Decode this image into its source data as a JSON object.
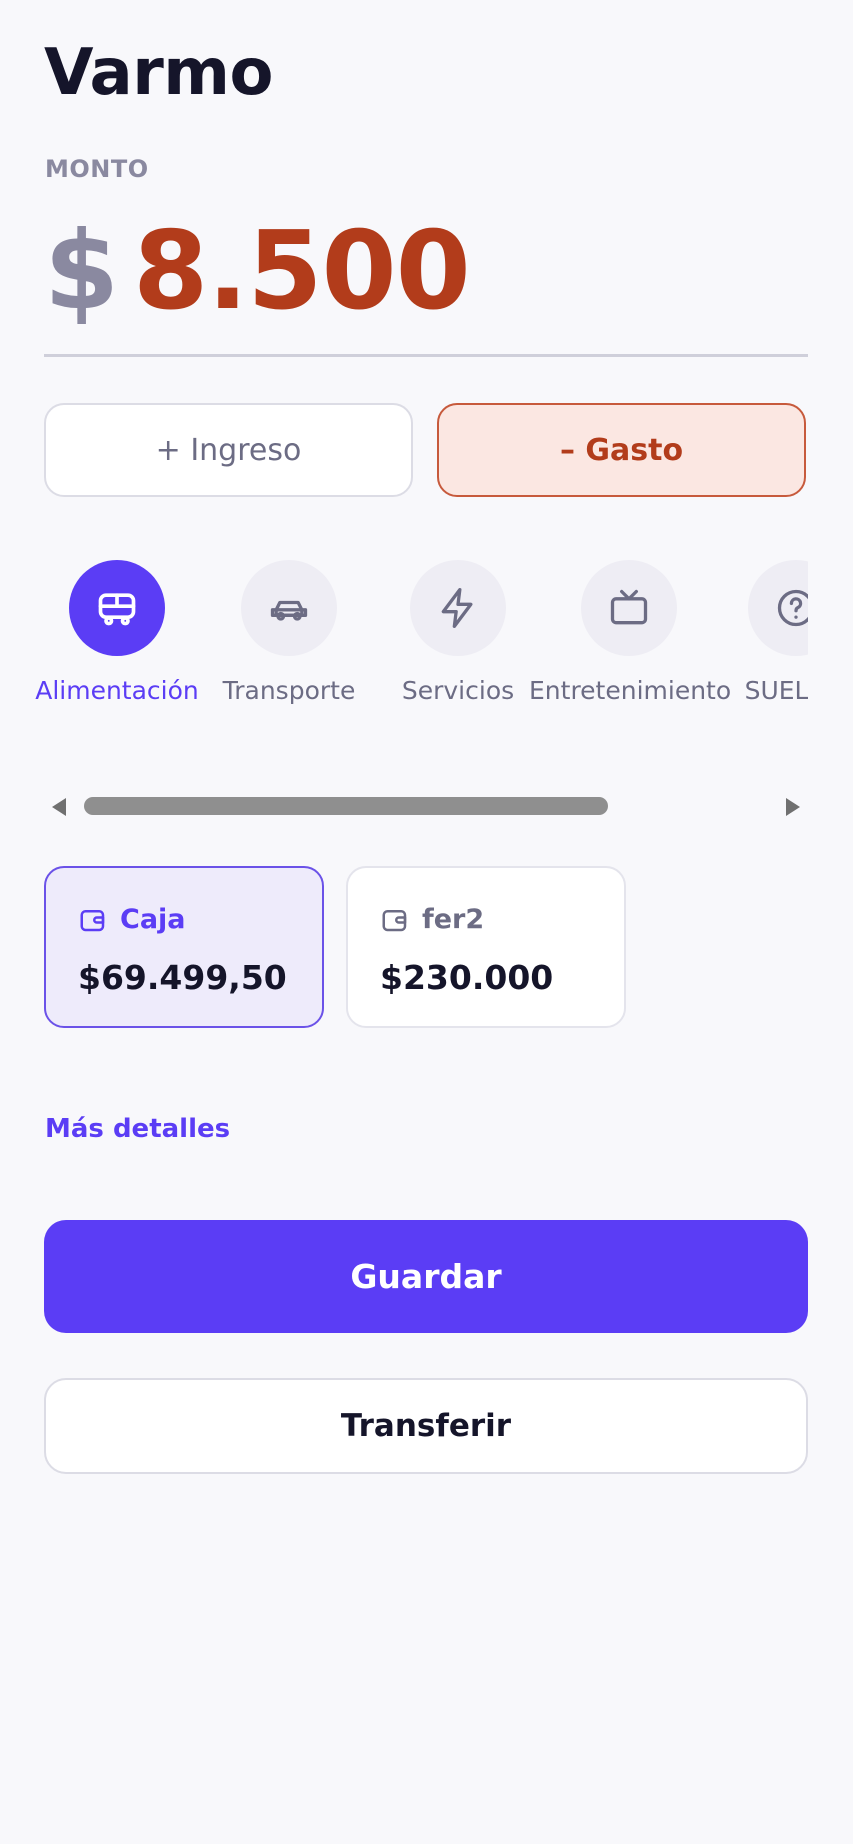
{
  "app": {
    "title": "Varmo"
  },
  "amount": {
    "label": "MONTO",
    "currency": "$",
    "value": "8.500"
  },
  "type_toggle": {
    "income_label": "+ Ingreso",
    "expense_label": "– Gasto",
    "selected": "expense"
  },
  "categories": [
    {
      "label": "Alimentación",
      "icon": "bus-icon",
      "active": true
    },
    {
      "label": "Transporte",
      "icon": "car-icon",
      "active": false
    },
    {
      "label": "Servicios",
      "icon": "lightning-icon",
      "active": false
    },
    {
      "label": "Entretenimiento",
      "icon": "tv-icon",
      "active": false
    },
    {
      "label": "SUELDO",
      "icon": "question-icon",
      "active": false
    }
  ],
  "accounts": [
    {
      "name": "Caja",
      "balance": "$69.499,50",
      "icon": "wallet-icon",
      "selected": true
    },
    {
      "name": "fer2",
      "balance": "$230.000",
      "icon": "wallet-icon",
      "selected": false
    }
  ],
  "links": {
    "more_details": "Más detalles"
  },
  "actions": {
    "save_label": "Guardar",
    "transfer_label": "Transferir"
  },
  "colors": {
    "accent": "#5b3df5",
    "expense": "#b23c1b",
    "muted": "#8a89a0",
    "background": "#f8f8fb"
  }
}
